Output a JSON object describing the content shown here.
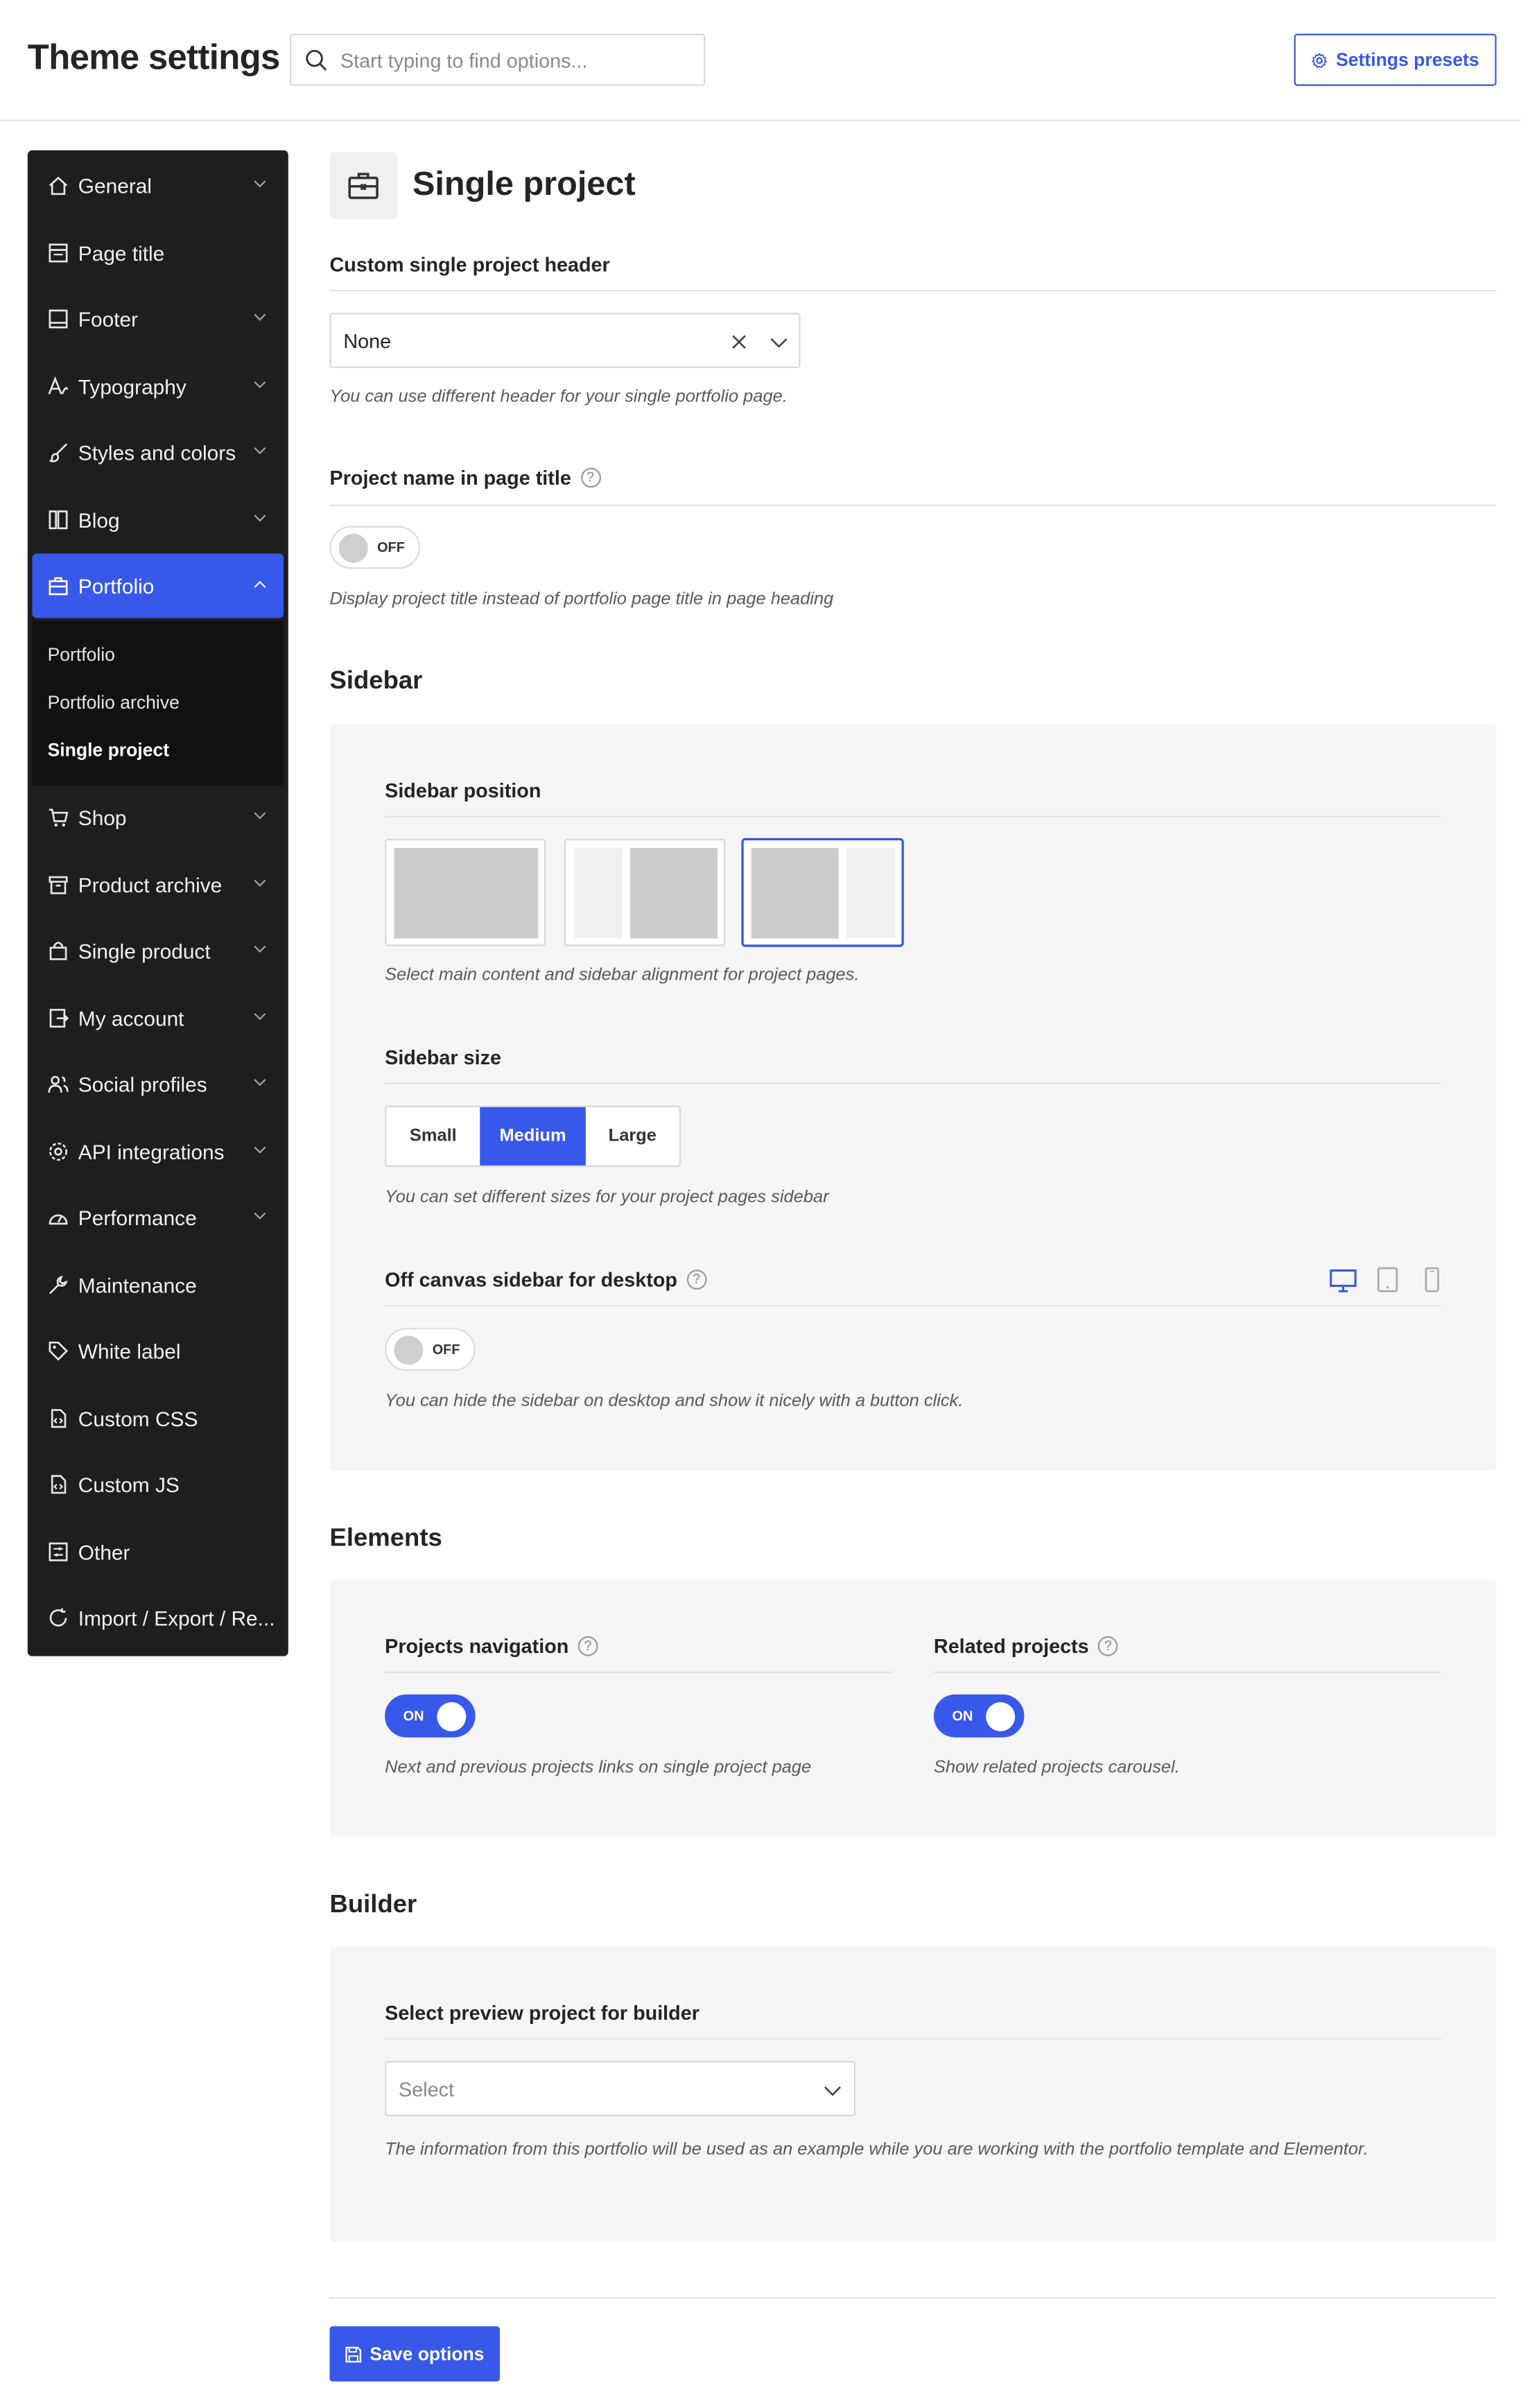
{
  "header": {
    "title": "Theme settings",
    "search_placeholder": "Start typing to find options...",
    "presets_label": "Settings presets"
  },
  "sidebar": {
    "items": [
      {
        "label": "General",
        "icon": "home-icon",
        "expandable": true
      },
      {
        "label": "Page title",
        "icon": "page-title-icon",
        "expandable": false
      },
      {
        "label": "Footer",
        "icon": "footer-icon",
        "expandable": true
      },
      {
        "label": "Typography",
        "icon": "typography-icon",
        "expandable": true
      },
      {
        "label": "Styles and colors",
        "icon": "brush-icon",
        "expandable": true
      },
      {
        "label": "Blog",
        "icon": "blog-icon",
        "expandable": true
      },
      {
        "label": "Portfolio",
        "icon": "briefcase-icon",
        "expandable": true,
        "active": true
      },
      {
        "label": "Shop",
        "icon": "cart-icon",
        "expandable": true
      },
      {
        "label": "Product archive",
        "icon": "archive-icon",
        "expandable": true
      },
      {
        "label": "Single product",
        "icon": "bag-icon",
        "expandable": true
      },
      {
        "label": "My account",
        "icon": "account-icon",
        "expandable": true
      },
      {
        "label": "Social profiles",
        "icon": "users-icon",
        "expandable": true
      },
      {
        "label": "API integrations",
        "icon": "gear-icon",
        "expandable": true
      },
      {
        "label": "Performance",
        "icon": "gauge-icon",
        "expandable": true
      },
      {
        "label": "Maintenance",
        "icon": "wrench-icon",
        "expandable": false
      },
      {
        "label": "White label",
        "icon": "tag-icon",
        "expandable": false
      },
      {
        "label": "Custom CSS",
        "icon": "css-file-icon",
        "expandable": false
      },
      {
        "label": "Custom JS",
        "icon": "js-file-icon",
        "expandable": false
      },
      {
        "label": "Other",
        "icon": "sliders-icon",
        "expandable": false
      },
      {
        "label": "Import / Export / Re...",
        "icon": "refresh-icon",
        "expandable": false
      }
    ],
    "portfolio_sub": [
      "Portfolio",
      "Portfolio archive",
      "Single project"
    ],
    "portfolio_current": "Single project"
  },
  "page": {
    "title": "Single project",
    "custom_header": {
      "label": "Custom single project header",
      "value": "None",
      "hint": "You can use different header for your single portfolio page."
    },
    "project_name": {
      "label": "Project name in page title",
      "state": "OFF",
      "hint": "Display project title instead of portfolio page title in page heading"
    },
    "sidebar_section": {
      "title": "Sidebar",
      "position_label": "Sidebar position",
      "position_options": [
        "without",
        "left",
        "right"
      ],
      "position_selected": "right",
      "position_hint": "Select main content and sidebar alignment for project pages.",
      "size_label": "Sidebar size",
      "sizes": [
        "Small",
        "Medium",
        "Large"
      ],
      "size_selected": "Medium",
      "size_hint": "You can set different sizes for your project pages sidebar",
      "offcanvas_label": "Off canvas sidebar for desktop",
      "offcanvas_state": "OFF",
      "offcanvas_hint": "You can hide the sidebar on desktop and show it nicely with a button click.",
      "devices": [
        "desktop-icon",
        "tablet-icon",
        "mobile-icon"
      ],
      "device_active": "desktop-icon"
    },
    "elements_section": {
      "title": "Elements",
      "nav_label": "Projects navigation",
      "nav_state": "ON",
      "nav_hint": "Next and previous projects links on single project page",
      "related_label": "Related projects",
      "related_state": "ON",
      "related_hint": "Show related projects carousel."
    },
    "builder_section": {
      "title": "Builder",
      "preview_label": "Select preview project for builder",
      "preview_placeholder": "Select",
      "preview_hint": "The information from this portfolio will be used as an example while you are working with the portfolio template and Elementor."
    },
    "save_label": "Save options"
  },
  "colors": {
    "accent": "#3858e9",
    "sidebar_bg": "#1e1e1e",
    "panel_bg": "#f6f6f6"
  }
}
